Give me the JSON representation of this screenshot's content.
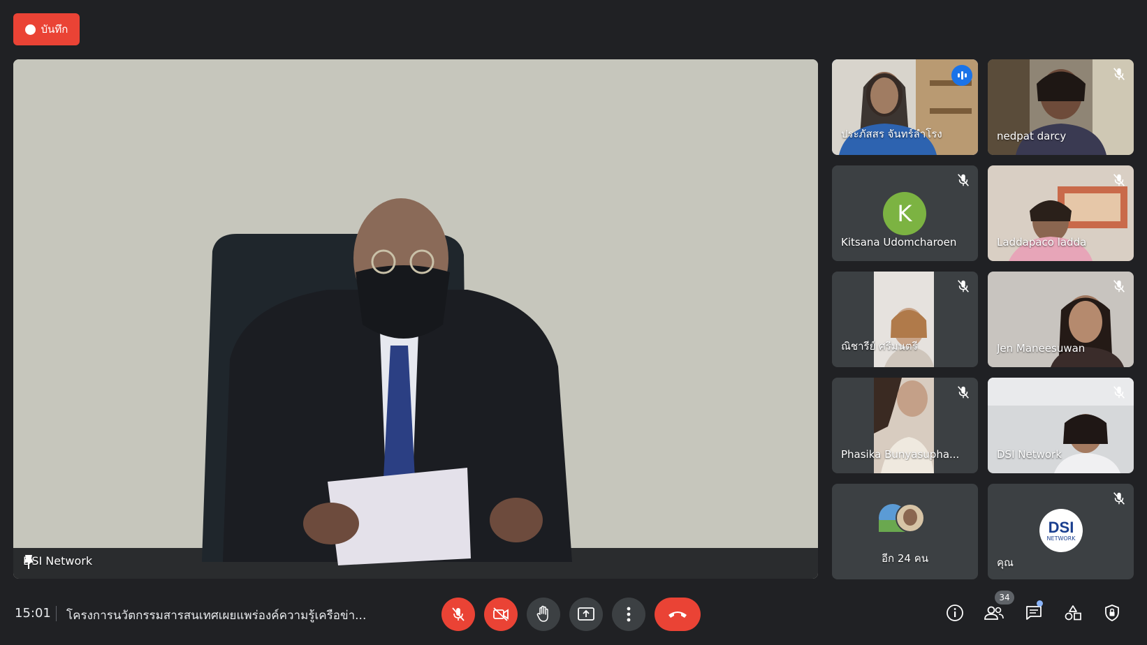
{
  "recording": {
    "label": "บันทึก",
    "color": "#ea4335"
  },
  "main_video": {
    "name": "DSI Network",
    "pin_icon": "pin-icon"
  },
  "participants": [
    {
      "name": "ประภัสสร จันทร์ลำโรง",
      "speaking": true
    },
    {
      "name": "nedpat darcy",
      "muted": true
    },
    {
      "name": "Kitsana Udomcharoen",
      "avatar_letter": "K",
      "avatar_color": "#7cb342",
      "muted": true
    },
    {
      "name": "Laddapaco ladda",
      "muted": true
    },
    {
      "name": "ณิชารีย์ ศรีมนตรี",
      "muted": true
    },
    {
      "name": "Jen Maneesuwan",
      "muted": true
    },
    {
      "name": "Phasika Bunyasupha...",
      "muted": true
    },
    {
      "name": "DSI Network",
      "muted": true
    }
  ],
  "others": {
    "label": "อีก 24 คน"
  },
  "self": {
    "label": "คุณ",
    "logo_text": "DSI",
    "logo_subtext": "NETWORK",
    "muted": true
  },
  "bottom_bar": {
    "time": "15:01",
    "meeting_title": "โครงการนวัตกรรมสารสนเทศเผยแพร่องค์ความรู้เครือข่า...",
    "people_count": "34"
  },
  "colors": {
    "background": "#202124",
    "tile": "#3c4043",
    "danger": "#ea4335",
    "accent": "#1a73e8"
  }
}
